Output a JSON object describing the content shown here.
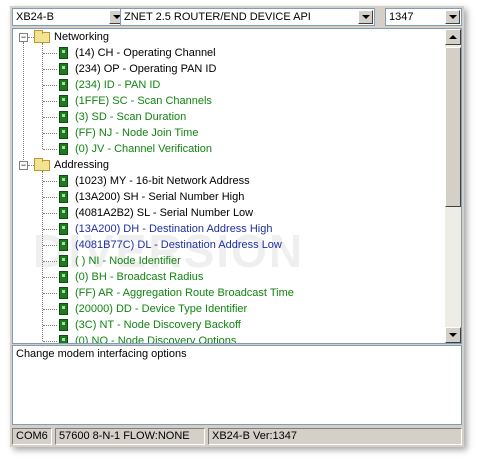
{
  "toolbar": {
    "modem": "XB24-B",
    "function_set": "ZNET 2.5 ROUTER/END DEVICE API",
    "version": "1347"
  },
  "tree": {
    "groups": [
      {
        "label": "Networking",
        "expander": "−",
        "items": [
          {
            "text": "(14) CH - Operating Channel",
            "color": "black"
          },
          {
            "text": "(234) OP - Operating PAN ID",
            "color": "black"
          },
          {
            "text": "(234) ID - PAN ID",
            "color": "green"
          },
          {
            "text": "(1FFE) SC - Scan Channels",
            "color": "green"
          },
          {
            "text": "(3) SD - Scan Duration",
            "color": "green"
          },
          {
            "text": "(FF) NJ - Node Join Time",
            "color": "green"
          },
          {
            "text": "(0) JV - Channel Verification",
            "color": "green"
          }
        ]
      },
      {
        "label": "Addressing",
        "expander": "−",
        "items": [
          {
            "text": "(1023) MY - 16-bit Network Address",
            "color": "black"
          },
          {
            "text": "(13A200) SH - Serial Number High",
            "color": "black"
          },
          {
            "text": "(4081A2B2) SL - Serial Number Low",
            "color": "black"
          },
          {
            "text": "(13A200) DH - Destination Address High",
            "color": "blue"
          },
          {
            "text": "(4081B77C) DL - Destination Address Low",
            "color": "blue"
          },
          {
            "text": "( ) NI - Node Identifier",
            "color": "green"
          },
          {
            "text": "(0) BH - Broadcast Radius",
            "color": "green"
          },
          {
            "text": "(FF) AR - Aggregation Route Broadcast Time",
            "color": "green"
          },
          {
            "text": "(20000) DD - Device Type Identifier",
            "color": "green"
          },
          {
            "text": "(3C) NT - Node Discovery Backoff",
            "color": "green"
          },
          {
            "text": "(0) NO - Node Discovery Options",
            "color": "green"
          }
        ]
      }
    ],
    "watermark": "DIVERSION"
  },
  "description": "Change modem interfacing options",
  "status": {
    "port": "COM6",
    "settings": "57600 8-N-1  FLOW:NONE",
    "device": "XB24-B  Ver:1347"
  },
  "colors": {
    "black": "#000000",
    "green": "#118411",
    "blue": "#1f2fa0"
  }
}
